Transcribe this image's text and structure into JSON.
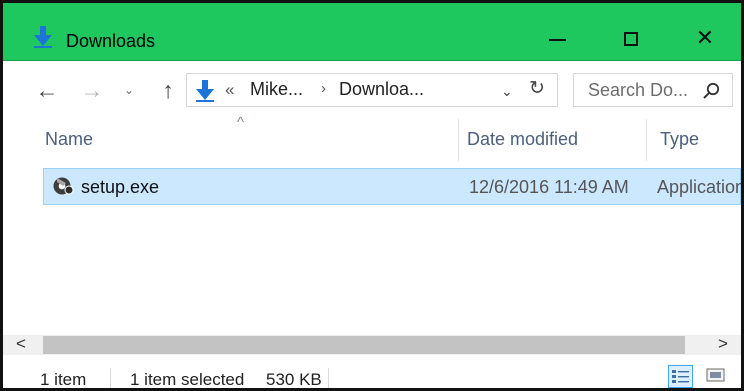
{
  "window": {
    "title": "Downloads",
    "accent_color": "#1ec85e",
    "controls": {
      "minimize_icon": "minimize-icon",
      "maximize_icon": "maximize-icon",
      "close_icon": "close-icon",
      "close_glyph": "✕"
    }
  },
  "navigation": {
    "back_glyph": "←",
    "forward_glyph": "→",
    "recent_glyph": "⌄",
    "up_glyph": "↑",
    "address": {
      "prefix": "«",
      "segments": [
        "Mike...",
        "Downloa..."
      ],
      "separator": "›",
      "dropdown_glyph": "⌄",
      "refresh_glyph": "↻"
    },
    "search": {
      "placeholder": "Search Do...",
      "icon": "search-icon"
    }
  },
  "columns": {
    "name": "Name",
    "date_modified": "Date modified",
    "type": "Type",
    "sort_indicator": "^"
  },
  "files": [
    {
      "name": "setup.exe",
      "date_modified": "12/6/2016 11:49 AM",
      "type": "Application",
      "icon": "installer-icon",
      "selected": true
    }
  ],
  "scrollbar": {
    "left_glyph": "<",
    "right_glyph": ">"
  },
  "status": {
    "item_count": "1 item",
    "selected_items": "1 item selected",
    "size": "530 KB"
  },
  "views": {
    "details_icon": "details-view-icon",
    "tiles_icon": "large-icons-view-icon"
  }
}
